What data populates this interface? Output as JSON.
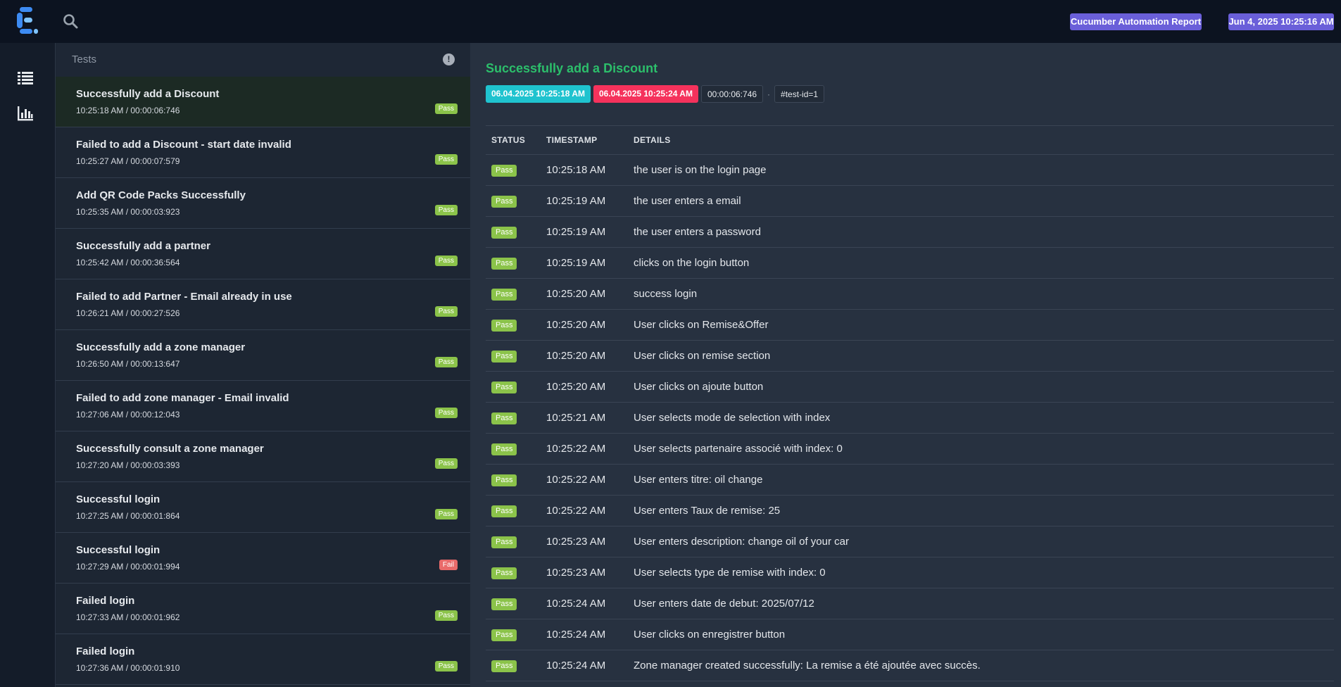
{
  "topbar": {
    "report_badge": "Cucumber Automation Report",
    "date_badge": "Jun 4, 2025 10:25:16 AM"
  },
  "icons": {
    "logo": "extent-logo-icon",
    "search": "search-icon",
    "tests_view": "list-icon",
    "dashboard_view": "bar-chart-icon",
    "info": "info-icon"
  },
  "colors": {
    "pass": "#8bc34a",
    "fail": "#e96a6a",
    "accent": "#6a5fd9",
    "title_green": "#2cbf6b",
    "start_chip": "#1fc3cf",
    "end_chip": "#f5325c"
  },
  "list": {
    "header": "Tests",
    "info_glyph": "!",
    "items": [
      {
        "name": "Successfully add a Discount",
        "meta": "10:25:18 AM / 00:00:06:746",
        "status": "Pass"
      },
      {
        "name": "Failed to add a Discount - start date invalid",
        "meta": "10:25:27 AM / 00:00:07:579",
        "status": "Pass"
      },
      {
        "name": "Add QR Code Packs Successfully",
        "meta": "10:25:35 AM / 00:00:03:923",
        "status": "Pass"
      },
      {
        "name": "Successfully add a partner",
        "meta": "10:25:42 AM / 00:00:36:564",
        "status": "Pass"
      },
      {
        "name": "Failed to add Partner - Email already in use",
        "meta": "10:26:21 AM / 00:00:27:526",
        "status": "Pass"
      },
      {
        "name": "Successfully add a zone manager",
        "meta": "10:26:50 AM / 00:00:13:647",
        "status": "Pass"
      },
      {
        "name": "Failed to add zone manager - Email invalid",
        "meta": "10:27:06 AM / 00:00:12:043",
        "status": "Pass"
      },
      {
        "name": "Successfully consult a zone manager",
        "meta": "10:27:20 AM / 00:00:03:393",
        "status": "Pass"
      },
      {
        "name": "Successful login",
        "meta": "10:27:25 AM / 00:00:01:864",
        "status": "Pass"
      },
      {
        "name": "Successful login",
        "meta": "10:27:29 AM / 00:00:01:994",
        "status": "Fail"
      },
      {
        "name": "Failed login",
        "meta": "10:27:33 AM / 00:00:01:962",
        "status": "Pass"
      },
      {
        "name": "Failed login",
        "meta": "10:27:36 AM / 00:00:01:910",
        "status": "Pass"
      }
    ]
  },
  "detail": {
    "title": "Successfully add a Discount",
    "start": "06.04.2025 10:25:18 AM",
    "end": "06.04.2025 10:25:24 AM",
    "duration": "00:00:06:746",
    "separator": "·",
    "test_id": "#test-id=1",
    "columns": [
      "STATUS",
      "TIMESTAMP",
      "DETAILS"
    ],
    "steps": [
      {
        "status": "Pass",
        "time": "10:25:18 AM",
        "details": "the user is on the login page"
      },
      {
        "status": "Pass",
        "time": "10:25:19 AM",
        "details": "the user enters a email"
      },
      {
        "status": "Pass",
        "time": "10:25:19 AM",
        "details": "the user enters a password"
      },
      {
        "status": "Pass",
        "time": "10:25:19 AM",
        "details": "clicks on the login button"
      },
      {
        "status": "Pass",
        "time": "10:25:20 AM",
        "details": "success login"
      },
      {
        "status": "Pass",
        "time": "10:25:20 AM",
        "details": "User clicks on Remise&Offer"
      },
      {
        "status": "Pass",
        "time": "10:25:20 AM",
        "details": "User clicks on remise section"
      },
      {
        "status": "Pass",
        "time": "10:25:20 AM",
        "details": "User clicks on ajoute button"
      },
      {
        "status": "Pass",
        "time": "10:25:21 AM",
        "details": "User selects mode de selection with index"
      },
      {
        "status": "Pass",
        "time": "10:25:22 AM",
        "details": "User selects partenaire associé with index: 0"
      },
      {
        "status": "Pass",
        "time": "10:25:22 AM",
        "details": "User enters titre: oil change"
      },
      {
        "status": "Pass",
        "time": "10:25:22 AM",
        "details": "User enters Taux de remise: 25"
      },
      {
        "status": "Pass",
        "time": "10:25:23 AM",
        "details": "User enters description: change oil of your car"
      },
      {
        "status": "Pass",
        "time": "10:25:23 AM",
        "details": "User selects type de remise with index: 0"
      },
      {
        "status": "Pass",
        "time": "10:25:24 AM",
        "details": "User enters date de debut: 2025/07/12"
      },
      {
        "status": "Pass",
        "time": "10:25:24 AM",
        "details": "User clicks on enregistrer button"
      },
      {
        "status": "Pass",
        "time": "10:25:24 AM",
        "details": "Zone manager created successfully: La remise a été ajoutée avec succès."
      }
    ]
  }
}
